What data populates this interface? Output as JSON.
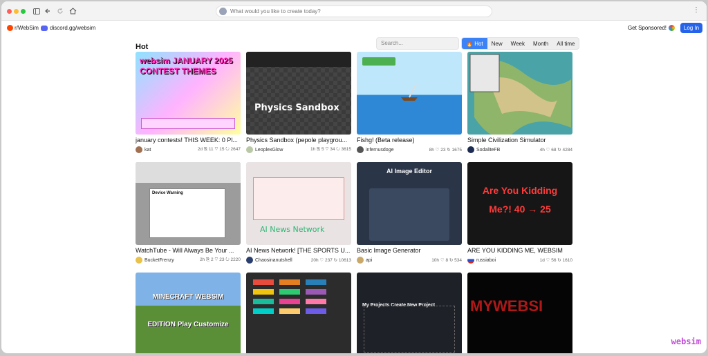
{
  "browser": {
    "address_placeholder": "What would you like to create today?"
  },
  "header": {
    "reddit_label": "r/WebSim",
    "discord_label": "discord.gg/websim",
    "sponsor_label": "Get Sponsored!",
    "login_label": "Log In"
  },
  "feed": {
    "title": "Hot",
    "search_placeholder": "Search...",
    "filters": [
      "Hot",
      "New",
      "Week",
      "Month",
      "All time"
    ],
    "active_filter": "Hot"
  },
  "cards": [
    {
      "title": "january contests! THIS WEEK: 0 Pl...",
      "author": "kat",
      "stats": "2d ⎘ 11 ♡ 15 ↻ 2647",
      "thumb_text": "websim JANUARY 2025 CONTEST THEMES"
    },
    {
      "title": "Physics Sandbox (pepole playgrou...",
      "author": "LeoplexGlow",
      "stats": "1h ⎘ 5 ♡ 34 ↻ 3615",
      "thumb_text": "Physics Sandbox"
    },
    {
      "title": "Fishg! (Beta release)",
      "author": "infernusdoge",
      "stats": "8h ♡ 23 ↻ 1675",
      "thumb_text": ""
    },
    {
      "title": "Simple Civilization Simulator",
      "author": "SodaliteFB",
      "stats": "4h ♡ 68 ↻ 4284",
      "thumb_text": ""
    },
    {
      "title": "WatchTube - Will Always Be Your ...",
      "author": "BucketFrenzy",
      "stats": "2h ⎘ 2 ♡ 23 ↻ 2220",
      "thumb_text": "Device Warning"
    },
    {
      "title": "AI News Network! [THE SPORTS U...",
      "author": "Chaosinanutshell",
      "stats": "20h ♡ 237 ↻ 10613",
      "thumb_text": "AI News Network"
    },
    {
      "title": "Basic Image Generator",
      "author": "api",
      "stats": "10h ♡ 8 ↻ 534",
      "thumb_text": "AI Image Editor"
    },
    {
      "title": "ARE YOU KIDDING ME, WEBSIM",
      "author": "russiaboi",
      "stats": "1d ♡ 56 ↻ 1610",
      "thumb_text": "Are You Kidding Me?! 40 → 25"
    },
    {
      "title": "",
      "author": "",
      "stats": "",
      "thumb_text": "MINECRAFT WEBSIM EDITION Play Customize"
    },
    {
      "title": "",
      "author": "",
      "stats": "",
      "thumb_text": ""
    },
    {
      "title": "",
      "author": "",
      "stats": "",
      "thumb_text": "My Projects Create New Project"
    },
    {
      "title": "",
      "author": "",
      "stats": "",
      "thumb_text": "MYWEBSI"
    }
  ],
  "watermark": "websim",
  "colors": {
    "accent": "#3b82f6",
    "login": "#2563eb"
  }
}
